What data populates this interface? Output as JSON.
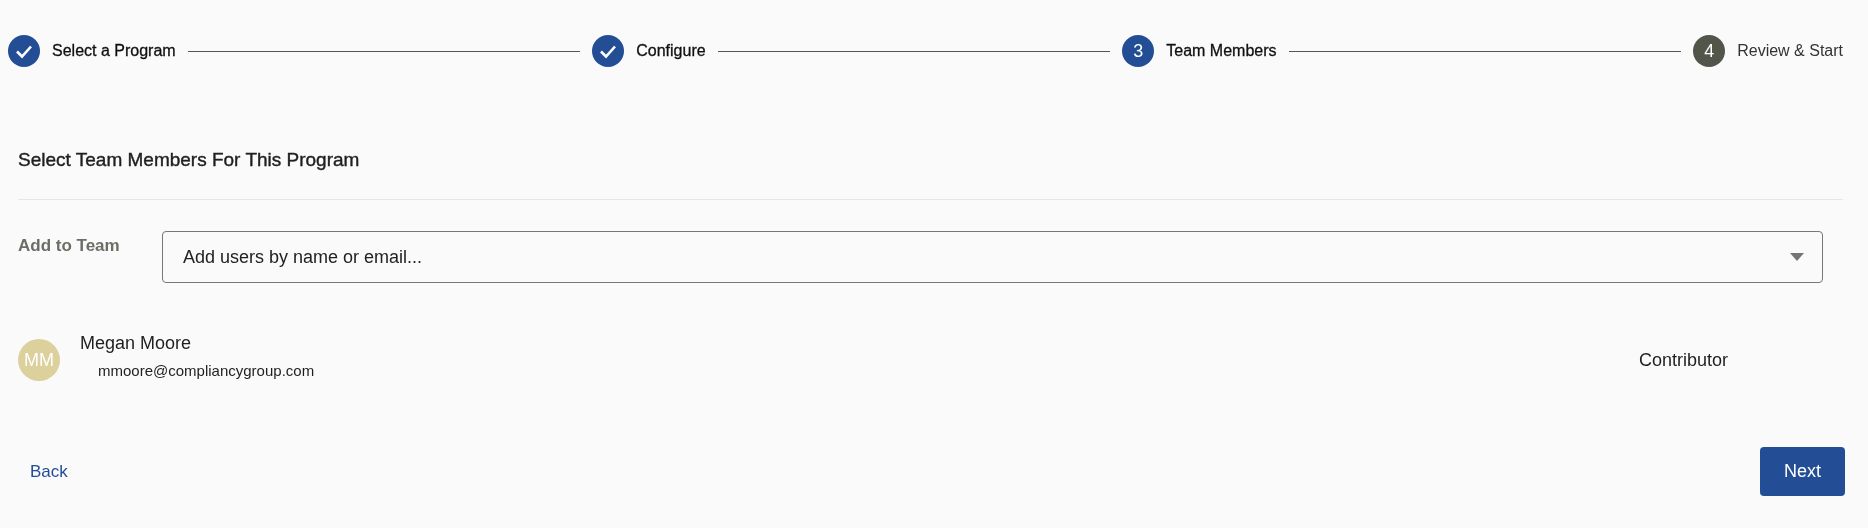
{
  "steps": [
    {
      "kind": "done",
      "label": "Select a Program"
    },
    {
      "kind": "done",
      "label": "Configure"
    },
    {
      "kind": "current",
      "number": "3",
      "label": "Team Members"
    },
    {
      "kind": "upcoming",
      "number": "4",
      "label": "Review & Start"
    }
  ],
  "heading": "Select Team Members For This Program",
  "add_to_team": {
    "label": "Add to Team",
    "placeholder": "Add users by name or email..."
  },
  "members": [
    {
      "initials": "MM",
      "name": "Megan Moore",
      "email": "mmoore@compliancygroup.com",
      "role": "Contributor"
    }
  ],
  "buttons": {
    "back": "Back",
    "next": "Next"
  }
}
